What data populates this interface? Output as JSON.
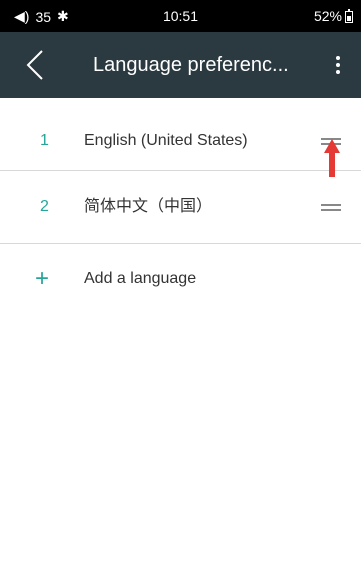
{
  "status": {
    "volume_icon": "volume-icon",
    "volume_value": "35",
    "bluetooth_icon": "bluetooth-icon",
    "time": "10:51",
    "battery": "52%"
  },
  "toolbar": {
    "title": "Language preferenc...",
    "back_icon": "chevron-left-icon",
    "more_icon": "more-vert-icon"
  },
  "languages": [
    {
      "index": "1",
      "label": "English (United States)"
    },
    {
      "index": "2",
      "label": "简体中文（中国）"
    }
  ],
  "add_language": {
    "icon": "+",
    "label": "Add a language"
  },
  "colors": {
    "toolbar": "#2b3a41",
    "accent": "#26a69a",
    "arrow": "#e53935"
  }
}
